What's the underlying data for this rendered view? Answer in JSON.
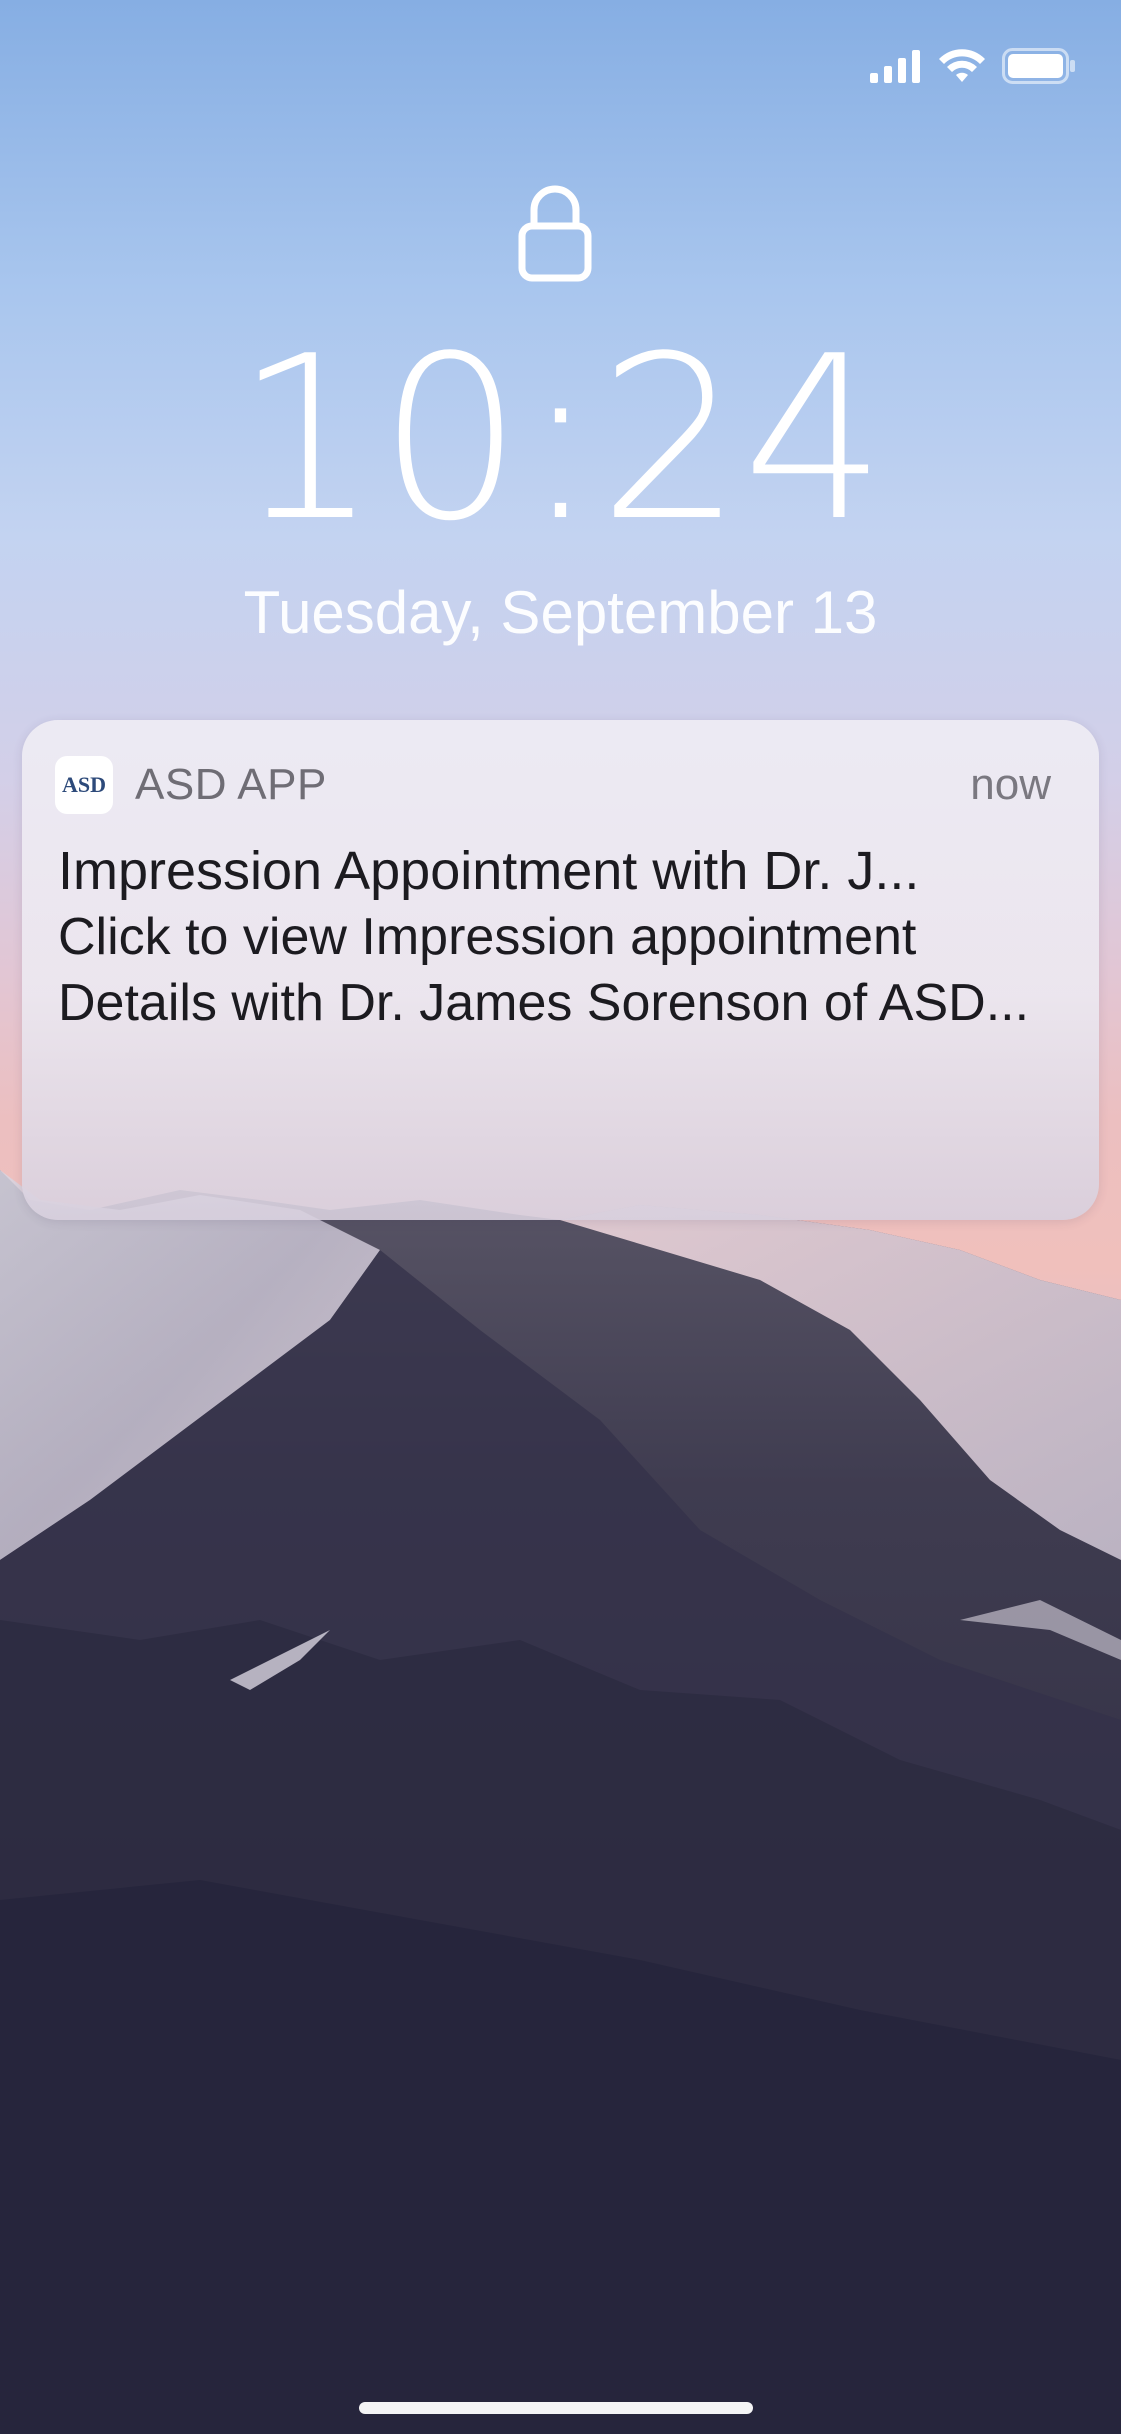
{
  "status_bar": {
    "signal_icon": "cellular-signal-icon",
    "wifi_icon": "wifi-icon",
    "battery_icon": "battery-icon",
    "battery_level": 1.0
  },
  "lock_screen": {
    "lock_icon": "lock-icon",
    "time": "10:24",
    "date": "Tuesday, September 13"
  },
  "notification": {
    "app_icon_text": "ASD",
    "app_name": "ASD APP",
    "time": "now",
    "title": "Impression Appointment with Dr. J...",
    "body": "Click to view Impression appointment Details with Dr. James Sorenson of ASD..."
  },
  "colors": {
    "text_white": "#ffffff",
    "notification_bg": "#ebe8f0",
    "title_text": "#1c1b20",
    "secondary_text": "#6f6d75"
  }
}
